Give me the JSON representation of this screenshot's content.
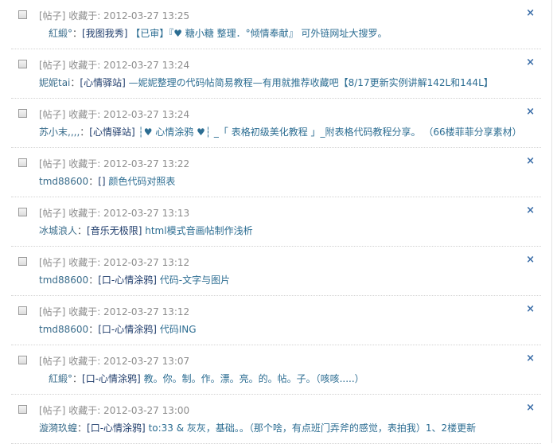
{
  "items": [
    {
      "type": "[帖子]",
      "favorited": "收藏于: 2012-03-27 13:25",
      "user": "紅緞°",
      "sep": "：",
      "forum": "[我图我秀]",
      "title": "【已审】『♥ 糖小糖 整理．°倾情奉献』 可外链网址大搜罗。",
      "indent": 47
    },
    {
      "type": "[帖子]",
      "favorited": "收藏于: 2012-03-27 13:24",
      "user": "妮妮tai",
      "sep": "：",
      "forum": "[心情驿站]",
      "title": "—妮妮整理の代码帖简易教程—有用就推荐收藏吧【8/17更新实例讲解142L和144L】",
      "indent": 35
    },
    {
      "type": "[帖子]",
      "favorited": "收藏于: 2012-03-27 13:24",
      "user": "苏小末,,,,",
      "sep": "：",
      "forum": "[心情驿站]",
      "title": "┆♥ 心情涂鸦 ♥┆ _「 表格初级美化教程 」_附表格代码教程分享。 （66楼菲菲分享素材）",
      "indent": 35
    },
    {
      "type": "[帖子]",
      "favorited": "收藏于: 2012-03-27 13:22",
      "user": "tmd88600",
      "sep": "：",
      "forum": "[]",
      "title": "颜色代码对照表",
      "indent": 35
    },
    {
      "type": "[帖子]",
      "favorited": "收藏于: 2012-03-27 13:13",
      "user": "冰城浪人",
      "sep": "：",
      "forum": "[音乐无极限]",
      "title": "html模式音画帖制作浅析",
      "indent": 35
    },
    {
      "type": "[帖子]",
      "favorited": "收藏于: 2012-03-27 13:12",
      "user": "tmd88600",
      "sep": "：",
      "forum": "[口-心情涂鸦]",
      "title": "代码-文字与图片",
      "indent": 35
    },
    {
      "type": "[帖子]",
      "favorited": "收藏于: 2012-03-27 13:12",
      "user": "tmd88600",
      "sep": "：",
      "forum": "[口-心情涂鸦]",
      "title": "代码ING",
      "indent": 35
    },
    {
      "type": "[帖子]",
      "favorited": "收藏于: 2012-03-27 13:07",
      "user": "紅緞°",
      "sep": "：",
      "forum": "[口-心情涂鸦]",
      "title": "教。你。制。作。漂。亮。的。帖。子。（咳咳.....）",
      "indent": 47
    },
    {
      "type": "[帖子]",
      "favorited": "收藏于: 2012-03-27 13:00",
      "user": "漩漪玖蝗",
      "sep": "：",
      "forum": "[口-心情涂鸦]",
      "title": "to:33 & 灰灰，基础。。（那个啥，有点班门弄斧的感觉，表拍我）1、2楼更新",
      "indent": 35
    }
  ],
  "delete_icon": "×"
}
